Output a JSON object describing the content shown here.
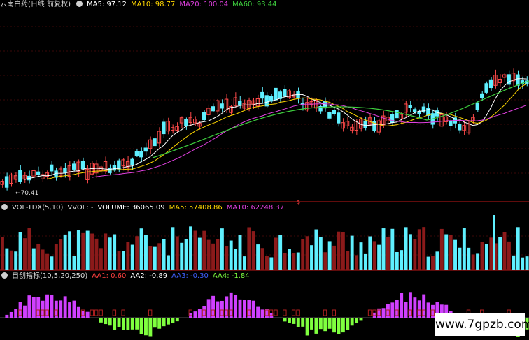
{
  "header": {
    "stock_name": "云南白药(日线 前复权)",
    "ma5_label": "MA5: 97.12",
    "ma10_label": "MA10: 98.77",
    "ma20_label": "MA20: 100.04",
    "ma60_label": "MA60: 93.44"
  },
  "volume_header": {
    "indicator": "VOL-TDX(5,10)",
    "vvol": "VVOL: -",
    "volume": "VOLUME: 36065.09",
    "ma5": "MA5: 57408.86",
    "ma10": "MA10: 62248.37"
  },
  "osc_header": {
    "indicator": "自创指标(10,5,20,250)",
    "aa1": "AA1: 0.60",
    "aa2": "AA2: -0.89",
    "aa3": "AA3: -0.30",
    "aa4": "AA4: -1.84"
  },
  "low_label": "70.41",
  "marker_label": "$",
  "watermark": "www.7gpzb.com",
  "colors": {
    "up": "#ff4a4a",
    "down": "#5ff0ff",
    "ma5": "#ffffff",
    "ma10": "#ffd700",
    "ma20": "#e040e0",
    "ma60": "#3ecf3e",
    "purple": "#d040ff",
    "green": "#7fff3f",
    "blue": "#3f5fff",
    "grid": "#7a1010"
  },
  "chart_data": {
    "type": "candlestick",
    "low_marker": 70.41,
    "last_values": {
      "MA5": 97.12,
      "MA10": 98.77,
      "MA20": 100.04,
      "MA60": 93.44
    },
    "volume_last": {
      "VOLUME": 36065.09,
      "MA5": 57408.86,
      "MA10": 62248.37
    },
    "oscillator_last": {
      "AA1": 0.6,
      "AA2": -0.89,
      "AA3": -0.3,
      "AA4": -1.84
    }
  }
}
